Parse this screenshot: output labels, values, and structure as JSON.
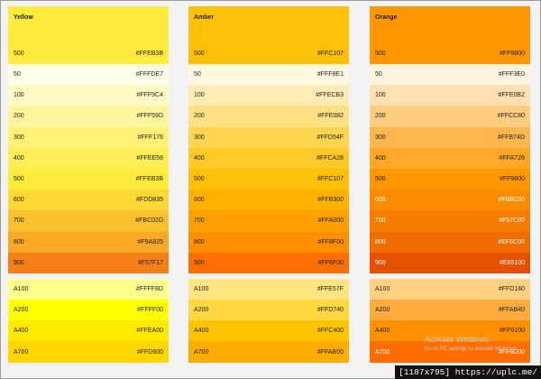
{
  "palettes": [
    {
      "name": "Yellow",
      "header": {
        "shade": "500",
        "hex": "#FFEB3B",
        "bg": "#FFEB3B",
        "fg": "#212121"
      },
      "shades": [
        {
          "shade": "50",
          "hex": "#FFFDE7",
          "bg": "#FFFDE7",
          "fg": "#212121"
        },
        {
          "shade": "100",
          "hex": "#FFF9C4",
          "bg": "#FFF9C4",
          "fg": "#212121"
        },
        {
          "shade": "200",
          "hex": "#FFF59D",
          "bg": "#FFF59D",
          "fg": "#212121"
        },
        {
          "shade": "300",
          "hex": "#FFF176",
          "bg": "#FFF176",
          "fg": "#212121"
        },
        {
          "shade": "400",
          "hex": "#FFEE58",
          "bg": "#FFEE58",
          "fg": "#212121"
        },
        {
          "shade": "500",
          "hex": "#FFEB3B",
          "bg": "#FFEB3B",
          "fg": "#212121"
        },
        {
          "shade": "600",
          "hex": "#FDD835",
          "bg": "#FDD835",
          "fg": "#212121"
        },
        {
          "shade": "700",
          "hex": "#FBC02D",
          "bg": "#FBC02D",
          "fg": "#212121"
        },
        {
          "shade": "800",
          "hex": "#F9A825",
          "bg": "#F9A825",
          "fg": "#212121"
        },
        {
          "shade": "900",
          "hex": "#F57F17",
          "bg": "#F57F17",
          "fg": "#212121"
        }
      ],
      "accents": [
        {
          "shade": "A100",
          "hex": "#FFFF8D",
          "bg": "#FFFF8D",
          "fg": "#212121"
        },
        {
          "shade": "A200",
          "hex": "#FFFF00",
          "bg": "#FFFF00",
          "fg": "#212121"
        },
        {
          "shade": "A400",
          "hex": "#FFEA00",
          "bg": "#FFEA00",
          "fg": "#212121"
        },
        {
          "shade": "A700",
          "hex": "#FFD600",
          "bg": "#FFD600",
          "fg": "#212121"
        }
      ]
    },
    {
      "name": "Amber",
      "header": {
        "shade": "500",
        "hex": "#FFC107",
        "bg": "#FFC107",
        "fg": "#212121"
      },
      "shades": [
        {
          "shade": "50",
          "hex": "#FFF8E1",
          "bg": "#FFF8E1",
          "fg": "#212121"
        },
        {
          "shade": "100",
          "hex": "#FFECB3",
          "bg": "#FFECB3",
          "fg": "#212121"
        },
        {
          "shade": "200",
          "hex": "#FFE082",
          "bg": "#FFE082",
          "fg": "#212121"
        },
        {
          "shade": "300",
          "hex": "#FFD54F",
          "bg": "#FFD54F",
          "fg": "#212121"
        },
        {
          "shade": "400",
          "hex": "#FFCA28",
          "bg": "#FFCA28",
          "fg": "#212121"
        },
        {
          "shade": "500",
          "hex": "#FFC107",
          "bg": "#FFC107",
          "fg": "#212121"
        },
        {
          "shade": "600",
          "hex": "#FFB300",
          "bg": "#FFB300",
          "fg": "#212121"
        },
        {
          "shade": "700",
          "hex": "#FFA000",
          "bg": "#FFA000",
          "fg": "#212121"
        },
        {
          "shade": "800",
          "hex": "#FF8F00",
          "bg": "#FF8F00",
          "fg": "#212121"
        },
        {
          "shade": "900",
          "hex": "#FF6F00",
          "bg": "#FF6F00",
          "fg": "#212121"
        }
      ],
      "accents": [
        {
          "shade": "A100",
          "hex": "#FFE57F",
          "bg": "#FFE57F",
          "fg": "#212121"
        },
        {
          "shade": "A200",
          "hex": "#FFD740",
          "bg": "#FFD740",
          "fg": "#212121"
        },
        {
          "shade": "A400",
          "hex": "#FFC400",
          "bg": "#FFC400",
          "fg": "#212121"
        },
        {
          "shade": "A700",
          "hex": "#FFAB00",
          "bg": "#FFAB00",
          "fg": "#212121"
        }
      ]
    },
    {
      "name": "Orange",
      "header": {
        "shade": "500",
        "hex": "#FF9800",
        "bg": "#FF9800",
        "fg": "#212121"
      },
      "shades": [
        {
          "shade": "50",
          "hex": "#FFF3E0",
          "bg": "#FFF3E0",
          "fg": "#212121"
        },
        {
          "shade": "100",
          "hex": "#FFE0B2",
          "bg": "#FFE0B2",
          "fg": "#212121"
        },
        {
          "shade": "200",
          "hex": "#FFCC80",
          "bg": "#FFCC80",
          "fg": "#212121"
        },
        {
          "shade": "300",
          "hex": "#FFB74D",
          "bg": "#FFB74D",
          "fg": "#212121"
        },
        {
          "shade": "400",
          "hex": "#FFA726",
          "bg": "#FFA726",
          "fg": "#212121"
        },
        {
          "shade": "500",
          "hex": "#FF9800",
          "bg": "#FF9800",
          "fg": "#212121"
        },
        {
          "shade": "600",
          "hex": "#FB8C00",
          "bg": "#FB8C00",
          "fg": "#ffffff"
        },
        {
          "shade": "700",
          "hex": "#F57C00",
          "bg": "#F57C00",
          "fg": "#ffffff"
        },
        {
          "shade": "800",
          "hex": "#EF6C00",
          "bg": "#EF6C00",
          "fg": "#ffffff"
        },
        {
          "shade": "900",
          "hex": "#E65100",
          "bg": "#E65100",
          "fg": "#ffffff"
        }
      ],
      "accents": [
        {
          "shade": "A100",
          "hex": "#FFD180",
          "bg": "#FFD180",
          "fg": "#212121"
        },
        {
          "shade": "A200",
          "hex": "#FFAB40",
          "bg": "#FFAB40",
          "fg": "#212121"
        },
        {
          "shade": "A400",
          "hex": "#FF9100",
          "bg": "#FF9100",
          "fg": "#212121"
        },
        {
          "shade": "A700",
          "hex": "#FF6D00",
          "bg": "#FF6D00",
          "fg": "#ffffff"
        }
      ]
    }
  ],
  "watermark": {
    "line1": "Activate Windows",
    "line2": "Go to PC settings to activate Windows."
  },
  "url_badge": "[1187x795] https://uplc.me/"
}
